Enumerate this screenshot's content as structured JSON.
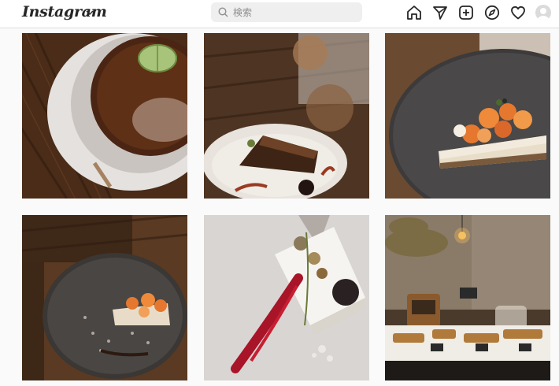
{
  "header": {
    "logo_text": "Instagram",
    "search_placeholder": "検索"
  },
  "nav_icons": [
    "home-icon",
    "direct-message-icon",
    "new-post-icon",
    "explore-icon",
    "activity-heart-icon",
    "profile-avatar"
  ],
  "grid": {
    "posts": [
      {
        "subject": "creme-brulee-dessert"
      },
      {
        "subject": "chocolate-tart-slice"
      },
      {
        "subject": "fruit-cake-slice"
      },
      {
        "subject": "plated-cake-slice"
      },
      {
        "subject": "white-cheesecake-with-berry-sauce"
      },
      {
        "subject": "bakery-display-counter"
      }
    ]
  },
  "colors": {
    "background": "#fafafa",
    "text": "#262626",
    "search_bg": "#efefef",
    "border": "#dbdbdb"
  }
}
